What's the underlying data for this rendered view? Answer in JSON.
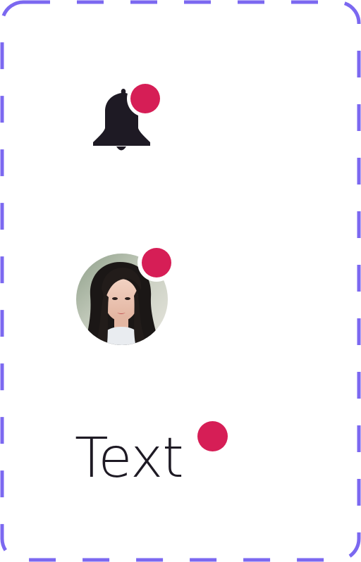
{
  "colors": {
    "border": "#7b68f0",
    "badge": "#d61e56",
    "ink": "#1e1a24",
    "background": "#ffffff"
  },
  "examples": {
    "bell": {
      "icon": "bell-icon",
      "badge": "notification-dot"
    },
    "avatar": {
      "image": "portrait-photo",
      "badge": "notification-dot"
    },
    "text": {
      "label": "Text",
      "badge": "notification-dot"
    }
  }
}
